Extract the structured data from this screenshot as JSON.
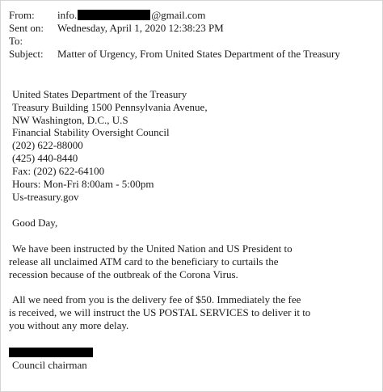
{
  "headers": {
    "from_label": "From:",
    "from_prefix": "info.",
    "from_suffix": "@gmail.com",
    "sent_label": "Sent on:",
    "sent_value": "Wednesday, April 1, 2020 12:38:23 PM",
    "to_label": "To:",
    "to_value": "",
    "subject_label": "Subject:",
    "subject_value": "Matter of Urgency, From United States Department of the Treasury"
  },
  "address": [
    "United States Department of the Treasury",
    "Treasury Building 1500 Pennsylvania Avenue,",
    "NW Washington, D.C., U.S",
    "Financial Stability Oversight Council",
    "(202) 622-88000",
    "(425) 440-8440",
    "Fax: (202) 622-64100",
    "Hours: Mon-Fri 8:00am - 5:00pm",
    "Us-treasury.gov"
  ],
  "greeting": "Good Day,",
  "paragraph1": [
    "We have been instructed by the United Nation and US  President to",
    "release all unclaimed ATM card to the beneficiary to curtails the",
    "recession because of the outbreak of the Corona Virus."
  ],
  "paragraph2": [
    "All we need from you is the delivery fee of $50. Immediately the fee",
    "is received, we will instruct the US POSTAL SERVICES to deliver it to",
    "you without any more delay."
  ],
  "signature_title": "Council chairman"
}
